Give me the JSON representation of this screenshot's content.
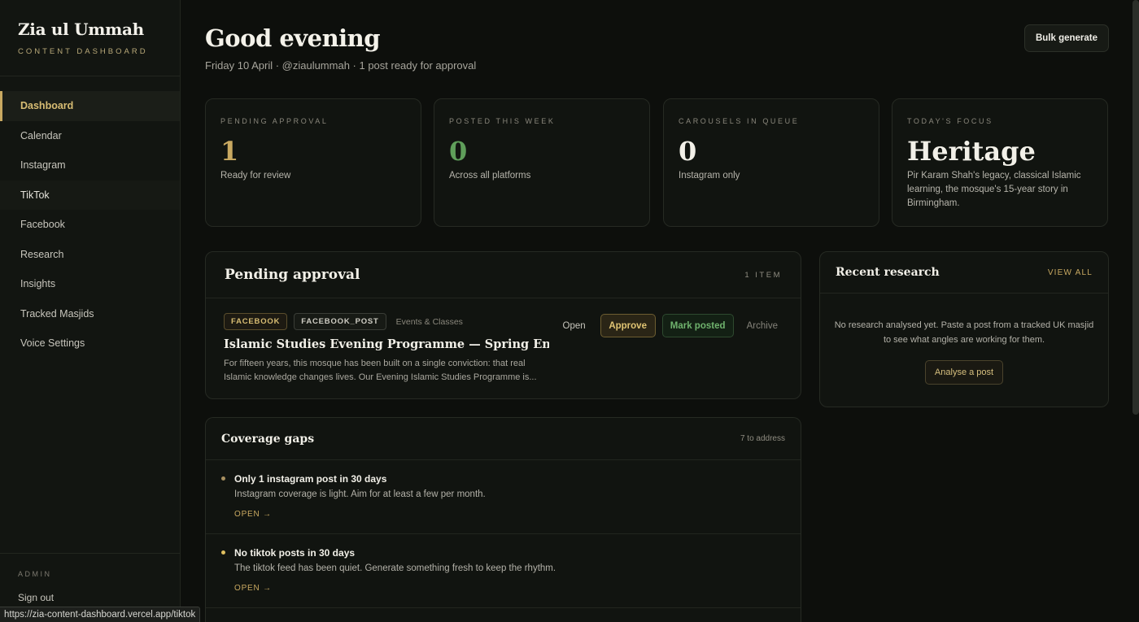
{
  "brand": {
    "title": "Zia ul Ummah",
    "subtitle": "CONTENT DASHBOARD"
  },
  "nav": [
    {
      "label": "Dashboard",
      "state": "active"
    },
    {
      "label": "Calendar",
      "state": ""
    },
    {
      "label": "Instagram",
      "state": ""
    },
    {
      "label": "TikTok",
      "state": "hover"
    },
    {
      "label": "Facebook",
      "state": ""
    },
    {
      "label": "Research",
      "state": ""
    },
    {
      "label": "Insights",
      "state": ""
    },
    {
      "label": "Tracked Masjids",
      "state": ""
    },
    {
      "label": "Voice Settings",
      "state": ""
    }
  ],
  "admin": {
    "label": "ADMIN",
    "signout": "Sign out"
  },
  "status_url": "https://zia-content-dashboard.vercel.app/tiktok",
  "header": {
    "greeting": "Good evening",
    "subline": "Friday 10 April · @ziaulummah · 1 post ready for approval",
    "bulk_button": "Bulk generate"
  },
  "stats": [
    {
      "label": "PENDING APPROVAL",
      "value": "1",
      "desc": "Ready for review",
      "color": "#c9a961"
    },
    {
      "label": "POSTED THIS WEEK",
      "value": "0",
      "desc": "Across all platforms",
      "color": "#5f9e5a"
    },
    {
      "label": "CAROUSELS IN QUEUE",
      "value": "0",
      "desc": "Instagram only",
      "color": "#f2f0e8"
    },
    {
      "label": "TODAY'S FOCUS",
      "value": "Heritage",
      "desc": "Pir Karam Shah's legacy, classical Islamic learning, the mosque's 15-year story in Birmingham.",
      "color": "#f2f0e8"
    }
  ],
  "pending": {
    "title": "Pending approval",
    "count": "1 ITEM",
    "item": {
      "platform_tag": "FACEBOOK",
      "type_tag": "FACEBOOK_POST",
      "category": "Events & Classes",
      "title": "Islamic Studies Evening Programme — Spring Enrolment ...",
      "excerpt": "For fifteen years, this mosque has been built on a single conviction: that real Islamic knowledge changes lives. Our Evening Islamic Studies Programme is...",
      "actions": {
        "open": "Open",
        "approve": "Approve",
        "mark_posted": "Mark posted",
        "archive": "Archive"
      }
    }
  },
  "research": {
    "title": "Recent research",
    "view_all": "VIEW ALL",
    "empty_text": "No research analysed yet. Paste a post from a tracked UK masjid to see what angles are working for them.",
    "button": "Analyse a post"
  },
  "coverage": {
    "title": "Coverage gaps",
    "meta": "7 to address",
    "items": [
      {
        "title": "Only 1 instagram post in 30 days",
        "desc": "Instagram coverage is light. Aim for at least a few per month.",
        "link": "OPEN →",
        "dot_color": "#a89060"
      },
      {
        "title": "No tiktok posts in 30 days",
        "desc": "The tiktok feed has been quiet. Generate something fresh to keep the rhythm.",
        "link": "OPEN →",
        "dot_color": "#e0c060"
      }
    ]
  }
}
